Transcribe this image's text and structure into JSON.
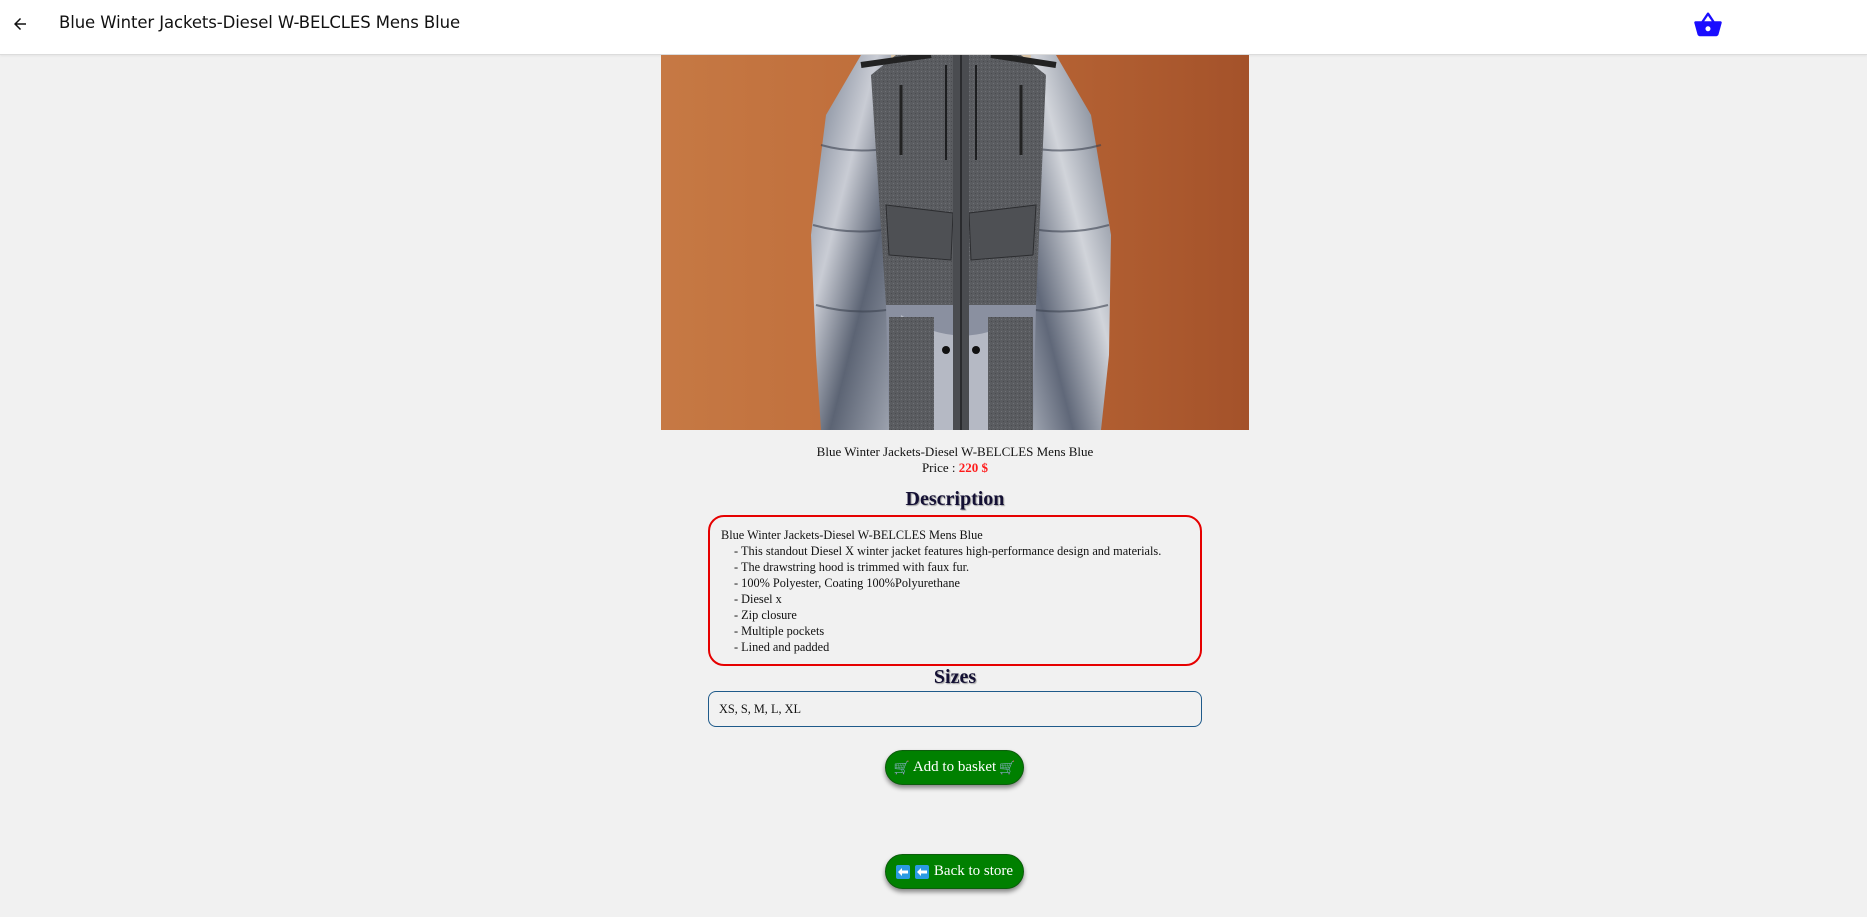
{
  "appbar": {
    "title": "Blue Winter Jackets-Diesel W-BELCLES Mens Blue",
    "back_icon": "arrow-left-icon",
    "basket_icon": "basket-icon",
    "basket_color": "#1a0dff"
  },
  "product": {
    "name": "Blue Winter Jackets-Diesel W-BELCLES Mens Blue",
    "price_label": "Price : ",
    "price_value": "220 $",
    "price_color": "#ff1a1a"
  },
  "description": {
    "heading": "Description",
    "title_line": "Blue Winter Jackets-Diesel W-BELCLES Mens Blue",
    "bullets": [
      "- This standout Diesel X winter jacket features high-performance design and materials.",
      "- The drawstring hood is trimmed with faux fur.",
      "- 100% Polyester, Coating 100%Polyurethane",
      "- Diesel x",
      "- Zip closure",
      "- Multiple pockets",
      "- Lined and padded"
    ],
    "border_color": "#e60000"
  },
  "sizes": {
    "heading": "Sizes",
    "value": "XS, S, M, L, XL"
  },
  "buttons": {
    "add_to_basket": "Add to basket",
    "add_icon": "shopping-cart-icon",
    "cart_glyph": "🛒",
    "back_to_store": "Back to store",
    "back_icon": "left-arrow-icon",
    "button_color": "#008000"
  }
}
